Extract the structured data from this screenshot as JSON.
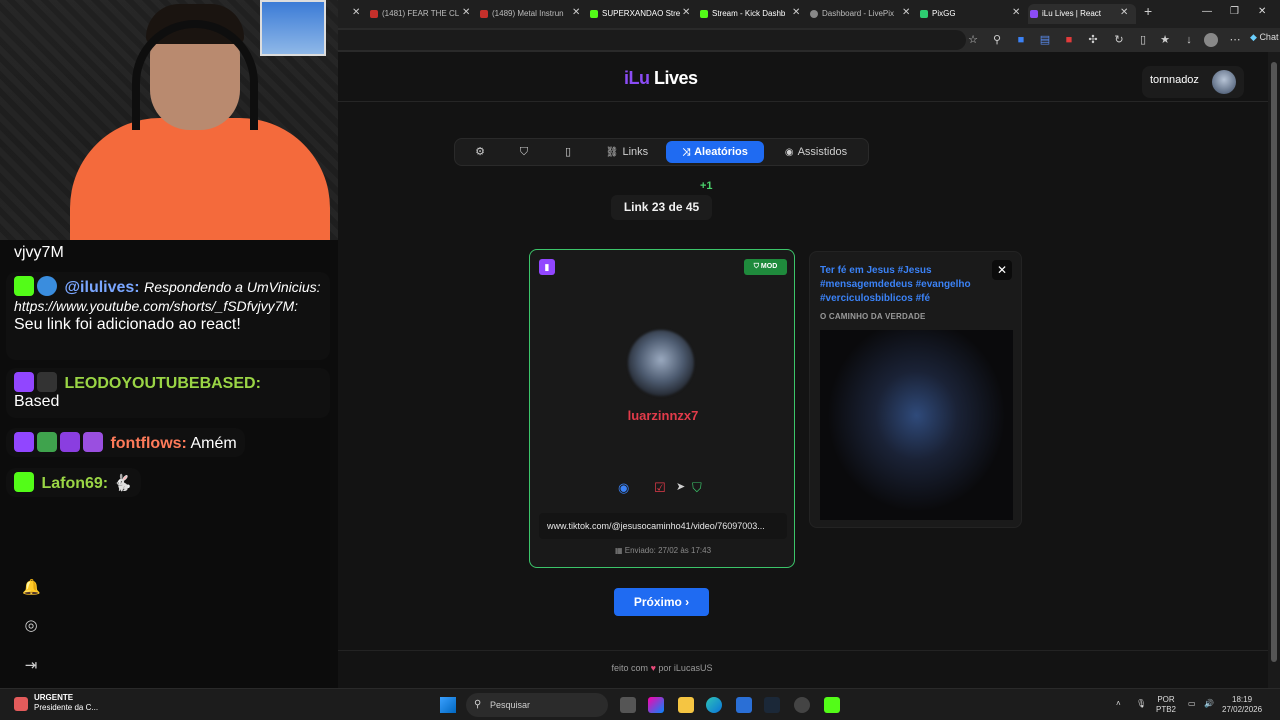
{
  "chat": {
    "messages": [
      {
        "text": "vjvy7M"
      },
      {
        "name": "@ilulives:",
        "italic": "Respondendo a UmVinicius: https://www.youtube.com/shorts/_fSDfvjvy7M:",
        "text": "Seu link foi adicionado ao react!"
      },
      {
        "name": "LEODOYOUTUBEBASED:",
        "text": "Based"
      },
      {
        "name": "fontflows:",
        "text": "Amém"
      },
      {
        "name": "Lafon69:"
      }
    ],
    "colors": {
      "ilulives": "#7aa6ff",
      "leo": "#9ad545",
      "fontflows": "#ff7b5a",
      "lafon": "#9ad545"
    }
  },
  "browser": {
    "tabs": [
      {
        "label": "(1481) FEAR THE CL"
      },
      {
        "label": "(1489) Metal Instrun"
      },
      {
        "label": "SUPERXANDAO Stre"
      },
      {
        "label": "Stream - Kick Dashb"
      },
      {
        "label": "Dashboard - LivePix"
      },
      {
        "label": "PixGG"
      },
      {
        "label": "iLu Lives | React"
      }
    ],
    "chat_label": "Chat"
  },
  "header": {
    "logo_ilu": "iLu",
    "logo_lives": "Lives",
    "username": "tornnadoz"
  },
  "nav": {
    "links": "Links",
    "aleatorios": "Aleatórios",
    "assistidos": "Assistidos"
  },
  "counter": {
    "plus": "+1",
    "label": "Link 23 de 45"
  },
  "card": {
    "mod": "MOD",
    "username": "luarzinnzx7",
    "url": "www.tiktok.com/@jesusocaminho41/video/76097003...",
    "sent": "Enviado: 27/02 às 17:43"
  },
  "preview": {
    "caption": "Ter fé em Jesus #Jesus #mensagemdedeus #evangelho #verciculosbiblicos #fé",
    "channel": "O CAMINHO DA VERDADE"
  },
  "next_label": "Próximo ›",
  "footer": {
    "before": "feito com",
    "after": "por iLucasUS"
  },
  "taskbar": {
    "news_title": "URGENTE",
    "news_sub": "Presidente da C...",
    "search": "Pesquisar",
    "lang1": "POR",
    "lang2": "PTB2",
    "time": "18:19",
    "date": "27/02/2026"
  }
}
